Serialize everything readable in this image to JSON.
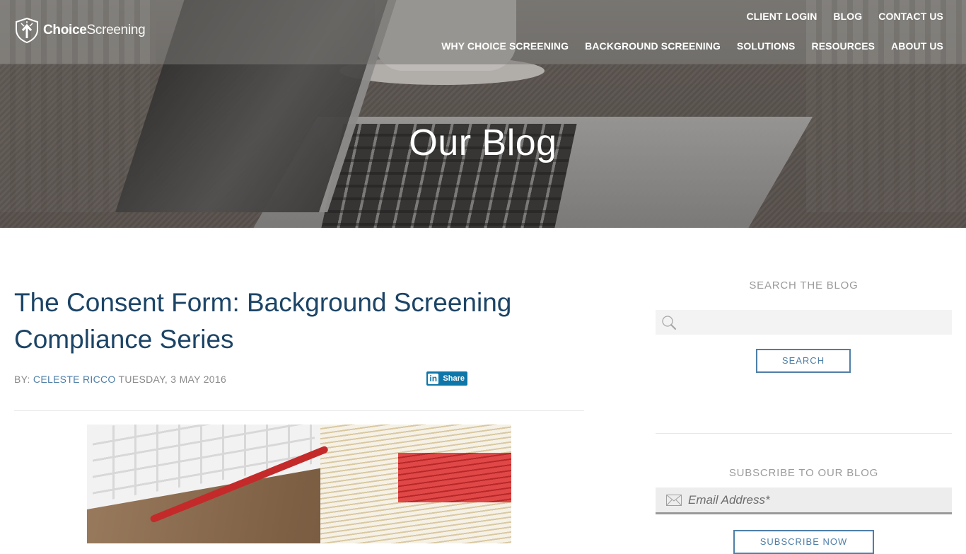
{
  "brand": {
    "name_bold": "Choice",
    "name_light": "Screening",
    "logo_icon": "shield-arrow-icon"
  },
  "nav": {
    "utility": [
      {
        "label": "CLIENT LOGIN"
      },
      {
        "label": "BLOG"
      },
      {
        "label": "CONTACT US"
      }
    ],
    "main": [
      {
        "label": "WHY CHOICE SCREENING"
      },
      {
        "label": "BACKGROUND SCREENING"
      },
      {
        "label": "SOLUTIONS"
      },
      {
        "label": "RESOURCES"
      },
      {
        "label": "ABOUT US"
      }
    ]
  },
  "hero": {
    "title": "Our Blog"
  },
  "post": {
    "title": "The Consent Form: Background Screening Compliance Series",
    "by_label": "BY:",
    "author": "CELESTE RICCO",
    "date": "TUESDAY, 3 MAY 2016",
    "share": {
      "network_glyph": "in",
      "label": "Share"
    },
    "image_alt": "Keyboard, red pen and stack of file folders on wooden desk"
  },
  "sidebar": {
    "search": {
      "heading": "SEARCH THE BLOG",
      "input_value": "",
      "input_placeholder": "",
      "button_label": "SEARCH"
    },
    "subscribe": {
      "heading": "SUBSCRIBE TO OUR BLOG",
      "input_placeholder": "Email Address*",
      "button_label": "SUBSCRIBE NOW"
    }
  },
  "colors": {
    "title_blue": "#1c4466",
    "link_blue": "#4f7fa8",
    "muted_gray": "#8a8a8a",
    "linkedin_blue": "#0e76a8"
  }
}
